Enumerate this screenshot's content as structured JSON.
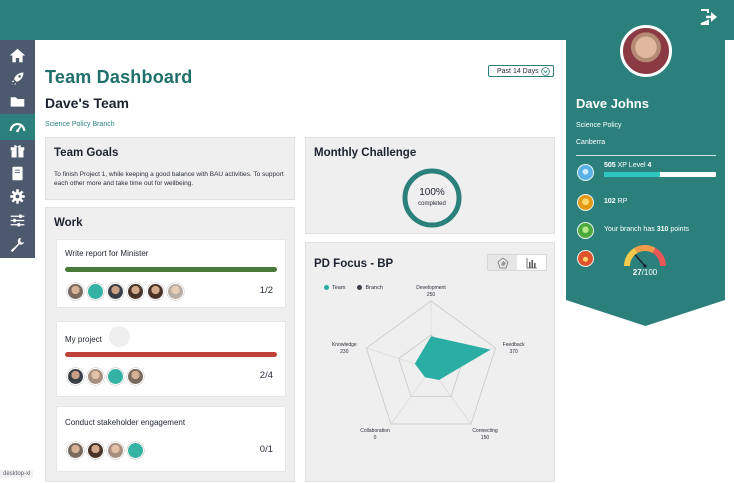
{
  "header": {
    "title": "Team Dashboard",
    "team_name": "Dave's Team",
    "branch": "Science Policy Branch",
    "period": "Past 14 Days"
  },
  "sidebar": {
    "items": [
      {
        "icon": "home-icon"
      },
      {
        "icon": "rocket-icon"
      },
      {
        "icon": "folder-icon"
      },
      {
        "icon": "dashboard-gauge-icon",
        "active": true
      },
      {
        "icon": "gift-icon"
      },
      {
        "icon": "book-icon"
      },
      {
        "icon": "gear-icon"
      },
      {
        "icon": "sliders-icon"
      },
      {
        "icon": "wrench-icon"
      }
    ]
  },
  "team_goals": {
    "title": "Team Goals",
    "text": "To finish Project 1, while keeping a good balance with BAU activities. To support each other more and take time out for wellbeing."
  },
  "work": {
    "title": "Work",
    "tasks": [
      {
        "name": "Write report for Minister",
        "count": "1/2",
        "bar_color": "#4a7a3a"
      },
      {
        "name": "My project",
        "count": "2/4",
        "bar_color": "#c0433b"
      },
      {
        "name": "Conduct stakeholder engagement",
        "count": "0/1"
      }
    ]
  },
  "monthly_challenge": {
    "title": "Monthly Challenge",
    "percent": "100%",
    "label": "completed"
  },
  "pd_focus": {
    "title": "PD Focus - BP",
    "legend": {
      "team": "Team",
      "branch": "Branch"
    },
    "team_color": "#2aaea3",
    "branch_color": "#3b3f48"
  },
  "chart_data": {
    "type": "radar",
    "categories": [
      "Development",
      "Feedback",
      "Connecting",
      "Collaboration",
      "Knowledge"
    ],
    "max_values": [
      "250",
      "370",
      "150",
      "0",
      "230"
    ],
    "series": [
      {
        "name": "Team",
        "values": [
          0.48,
          0.92,
          0.2,
          0.15,
          0.25
        ]
      }
    ]
  },
  "profile": {
    "name": "Dave Johns",
    "department": "Science Policy",
    "city": "Canberra",
    "xp": "505",
    "xp_label": "XP Level",
    "level": "4",
    "xp_progress": 0.5,
    "rp": "102",
    "rp_label": "RP",
    "branch_prefix": "Your branch has",
    "branch_points": "310",
    "branch_suffix": "points",
    "gauge_value": "27",
    "gauge_max": "/100",
    "gauge_fraction": 0.27
  },
  "footer": {
    "tag": "desktop-xl"
  }
}
